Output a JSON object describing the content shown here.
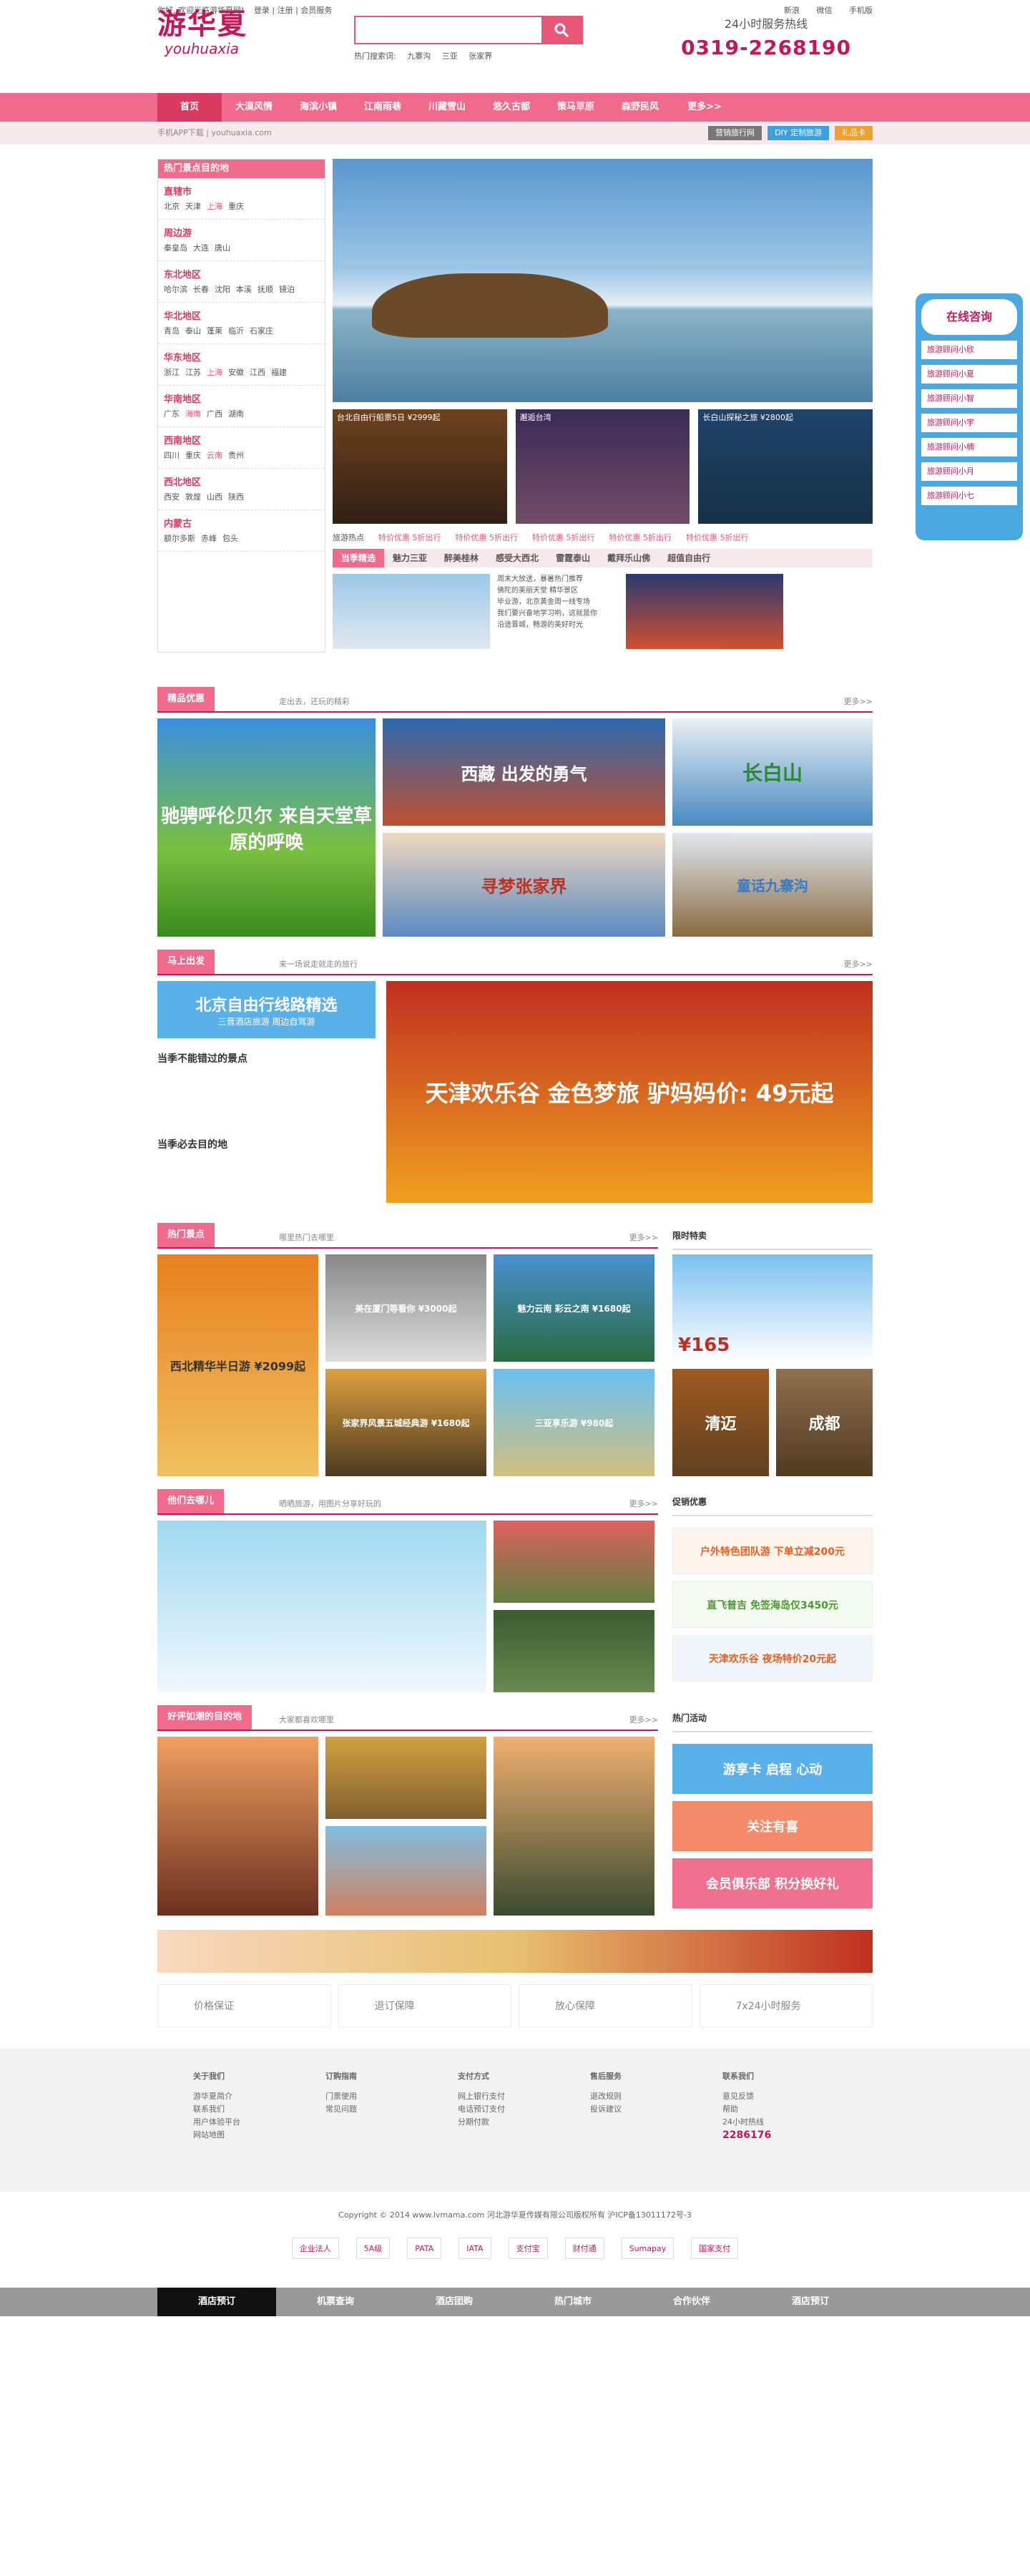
{
  "top": {
    "welcome": "你好, 欢迎光临游华夏网!",
    "login": "登录",
    "register": "注册",
    "member": "会员服务",
    "links": [
      "新浪",
      "微信",
      "手机版"
    ]
  },
  "logo": {
    "cn": "游华夏",
    "en": "youhuaxia"
  },
  "search": {
    "placeholder": "",
    "hot_label": "热门搜索词:",
    "hot": [
      "九寨沟",
      "三亚",
      "张家界"
    ]
  },
  "hotline": {
    "label": "24小时服务热线",
    "number": "0319-2268190"
  },
  "nav": [
    "首页",
    "大漠风情",
    "海滨小镇",
    "江南雨巷",
    "川藏雪山",
    "悠久古都",
    "策马草原",
    "森野民风",
    "更多>>"
  ],
  "subbar": {
    "text": "手机APP下载 | youhuaxia.com",
    "btns": [
      "营销旅行网",
      "DIY 定制旅游",
      "礼品卡"
    ]
  },
  "sidebar": {
    "title": "热门景点目的地",
    "groups": [
      {
        "t": "直辖市",
        "items": [
          "北京",
          "天津",
          "上海",
          "重庆"
        ]
      },
      {
        "t": "周边游",
        "items": [
          "秦皇岛",
          "大连",
          "唐山"
        ]
      },
      {
        "t": "东北地区",
        "items": [
          "哈尔滨",
          "长春",
          "沈阳",
          "本溪",
          "抚顺",
          "镜泊"
        ]
      },
      {
        "t": "华北地区",
        "items": [
          "青岛",
          "泰山",
          "蓬莱",
          "临沂",
          "石家庄"
        ]
      },
      {
        "t": "华东地区",
        "items": [
          "浙江",
          "江苏",
          "上海",
          "安徽",
          "江西",
          "福建"
        ]
      },
      {
        "t": "华南地区",
        "items": [
          "广东",
          "海南",
          "广西",
          "湖南"
        ]
      },
      {
        "t": "西南地区",
        "items": [
          "四川",
          "重庆",
          "云南",
          "贵州"
        ]
      },
      {
        "t": "西北地区",
        "items": [
          "西安",
          "敦煌",
          "山西",
          "陕西"
        ]
      },
      {
        "t": "内蒙古",
        "items": [
          "额尔多斯",
          "赤峰",
          "包头"
        ]
      }
    ]
  },
  "thumbs": [
    {
      "cap": "台北自由行船票5日 ¥2999起"
    },
    {
      "cap": "邂逅台湾"
    },
    {
      "cap": "长白山探秘之旅 ¥2800起"
    }
  ],
  "promo": [
    "旅游热点",
    "特价优惠 5折出行",
    "特价优惠 5折出行",
    "特价优惠 5折出行",
    "特价优惠 5折出行",
    "特价优惠 5折出行"
  ],
  "tabs": [
    "当季精选",
    "魅力三亚",
    "醉美桂林",
    "感受大西北",
    "雷霆泰山",
    "戴拜乐山佛",
    "超值自由行"
  ],
  "tabtext": [
    "周末大放送，暴暑热门推荐",
    "佛陀的美丽天堂 精华景区",
    "毕业游，北京黄金周一线专场",
    "我们要兴奋地学习哟，这就是你",
    "沿途晋城，畅游的美好时光"
  ],
  "sec1": {
    "title": "精品优惠",
    "desc": "走出去，还玩的精彩",
    "more": "更多>>",
    "blocks": [
      "驰骋呼伦贝尔 来自天堂草原的呼唤",
      "西藏 出发的勇气",
      "长白山",
      "寻梦张家界",
      "童话九寨沟"
    ]
  },
  "sec2": {
    "title": "马上出发",
    "desc": "来一场说走就走的旅行",
    "more": "更多>>",
    "left_title": "北京自由行线路精选",
    "left_sub": "三晋酒店旅游 周边自驾游",
    "must1": "当季不能错过的景点",
    "must2": "当季必去目的地",
    "banner": "天津欢乐谷 金色梦旅 驴妈妈价: 49元起"
  },
  "sec3": {
    "title": "热门景点",
    "desc": "哪里热门去哪里",
    "more": "更多>>",
    "right_title": "限时特卖",
    "caps": [
      "西北精华半日游 ¥2099起",
      "美在厦门等看你 ¥3000起",
      "魅力云南 彩云之南 ¥1680起",
      "张家界风景五城经典游 ¥1680起",
      "三亚享乐游 ¥980起"
    ],
    "deal_price": "¥165",
    "deals": [
      "清迈",
      "成都"
    ]
  },
  "sec4": {
    "title": "他们去哪儿",
    "desc": "晒晒旅游，用图片分享好玩的",
    "more": "更多>>",
    "right_title": "促销优惠",
    "promos": [
      "户外特色团队游 下单立减200元",
      "直飞普吉 免签海岛仅3450元",
      "天津欢乐谷 夜场特价20元起"
    ]
  },
  "sec5": {
    "title": "好评如潮的目的地",
    "desc": "大家都喜欢哪里",
    "more": "更多>>",
    "right_title": "热门活动",
    "acts": [
      "游享卡 启程 心动",
      "关注有喜",
      "会员俱乐部 积分换好礼"
    ]
  },
  "guarantees": [
    "价格保证",
    "退订保障",
    "放心保障",
    "7x24小时服务"
  ],
  "footer": {
    "cols": [
      {
        "t": "关于我们",
        "items": [
          "游华夏简介",
          "联系我们",
          "用户体验平台",
          "网站地图"
        ]
      },
      {
        "t": "订购指南",
        "items": [
          "门票使用",
          "常见问题"
        ]
      },
      {
        "t": "支付方式",
        "items": [
          "网上银行支付",
          "电话预订支付",
          "分期付款"
        ]
      },
      {
        "t": "售后服务",
        "items": [
          "退改规则",
          "投诉建议"
        ]
      },
      {
        "t": "联系我们",
        "items": [
          "意见反馈",
          "帮助",
          "24小时热线",
          "2286176"
        ]
      }
    ],
    "copy": "Copyright © 2014 www.lvmama.com 河北游华夏传媒有限公司版权所有 沪ICP备13011172号-3",
    "cert": [
      "企业法人",
      "5A级",
      "PATA",
      "IATA",
      "支付宝",
      "财付通",
      "Sumapay",
      "国家支付"
    ]
  },
  "botnav": [
    "酒店预订",
    "机票查询",
    "酒店团购",
    "热门城市",
    "合作伙伴",
    "酒店预订"
  ],
  "float": {
    "title": "在线咨询",
    "items": [
      "旅游顾问小欣",
      "旅游顾问小夏",
      "旅游顾问小智",
      "旅游顾问小宇",
      "旅游顾问小楠",
      "旅游顾问小月",
      "旅游顾问小七"
    ]
  }
}
